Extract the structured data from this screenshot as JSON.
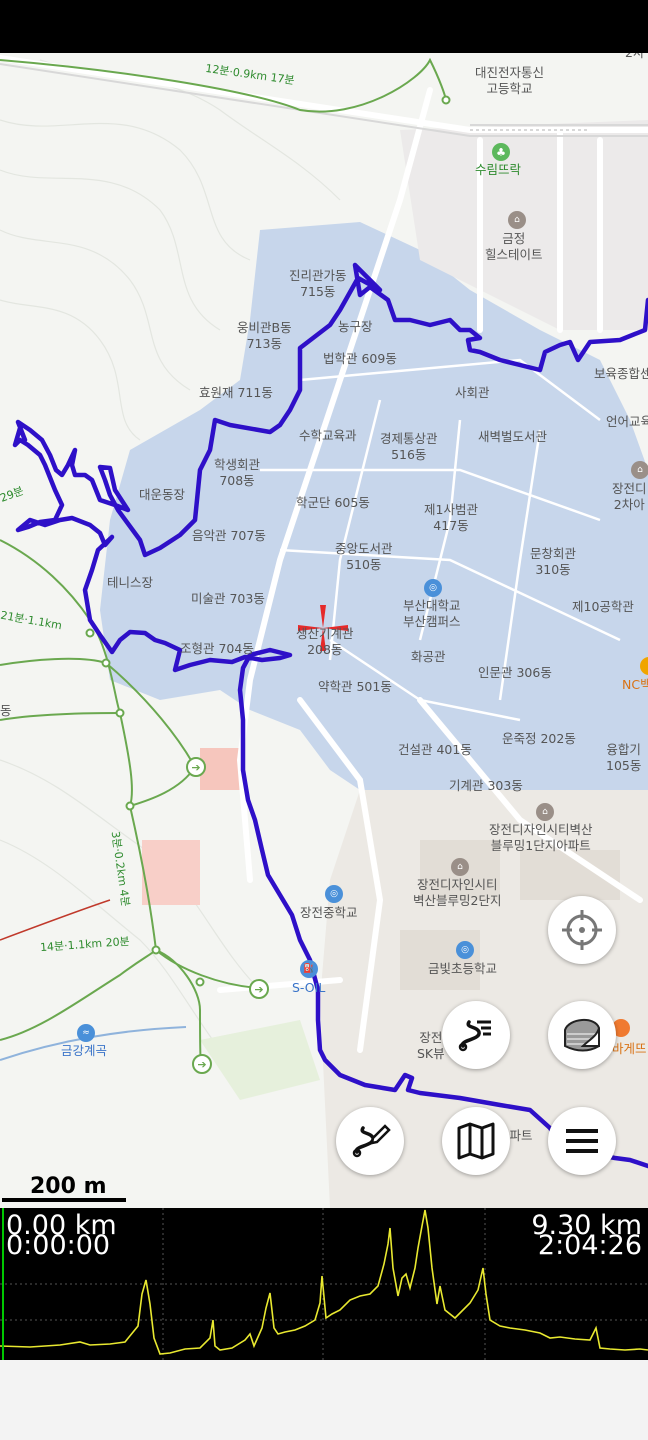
{
  "map": {
    "scale_label": "200 m",
    "labels": {
      "daejin": "대진전자통신\n고등학교",
      "surim": "수림뜨락",
      "geumjeong_hillstate": "금정\n힐스테이트",
      "jinrigwan": "진리관가동\n715동",
      "nonggujang": "농구장",
      "ungbigwan": "웅비관B동\n713동",
      "beophakgwan": "법학관 609동",
      "hyowonjae": "효원재 711동",
      "sahoegwan": "사회관",
      "boyuk": "보육종합센",
      "suhakgyoyuk": "수학교육과",
      "gyeongje": "경제통상관\n516동",
      "saebyeok": "새벽벌도서관",
      "eoneo": "언어교육",
      "haksaeng": "학생회관\n708동",
      "daeundongjang": "대운동장",
      "jangjeon2": "장전디\n2차아",
      "hakgundan": "학군단 605동",
      "je1sabeom": "제1사범관\n417동",
      "eumak": "음악관 707동",
      "jungang": "중앙도서관\n510동",
      "munchang": "문창회관\n310동",
      "tennis": "테니스장",
      "misul": "미술관 703동",
      "pnu": "부산대학교\n부산캠퍼스",
      "je10": "제10공학관",
      "johyeong": "조형관 704동",
      "saengsan": "생산기계관\n208동",
      "hwagong": "화공관",
      "inmun": "인문관 306동",
      "nc": "NC백",
      "yakhak": "약학관 501동",
      "geonseol": "건설관 401동",
      "unjukjeong": "운죽정 202동",
      "yunghap": "융합기\n105동",
      "gigye": "기계관 303동",
      "jangjeon_design1": "장전디자인시티벽산\n블루밍1단지아파트",
      "jangjeon_design2": "장전디자인시티\n벽산블루밍2단지",
      "jangjeon_middle": "장전중학교",
      "geumbit": "금빛초등학교",
      "sol": "S-OIL",
      "jangjeon_sk": "장전\nSK뷰",
      "geumgang": "금강계곡",
      "dong": "동",
      "apart": "아파트",
      "bakery": "바게뜨",
      "trail_1": "12분·0.9km 17분",
      "trail_2": "3분·0.2km 4분",
      "trail_3": "14분·1.1km 20분",
      "trail_4": "21분·1.1km",
      "trail_5": "29분",
      "top_right": "2차"
    }
  },
  "buttons": {
    "locate": "crosshair-icon",
    "layers": "layers-icon",
    "route_list": "route-list-icon",
    "edit_route": "edit-route-icon",
    "map_select": "map-icon",
    "menu": "menu-icon"
  },
  "elevation": {
    "start_distance": "0.00 km",
    "start_time": "0:00:00",
    "end_distance": "9.30 km",
    "end_time": "2:04:26"
  },
  "colors": {
    "track": "#2e10c8",
    "campus": "#c3d3ea",
    "profile": "#e8e830",
    "cursor": "#00c800"
  }
}
